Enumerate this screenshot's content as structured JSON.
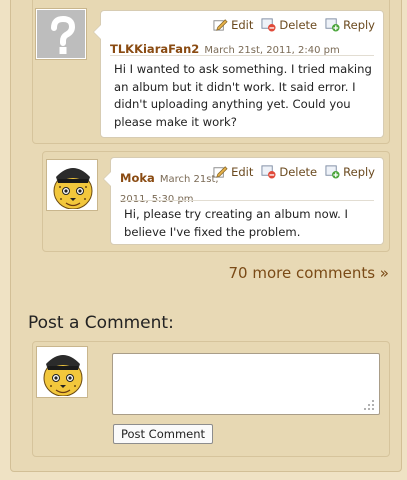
{
  "actions": {
    "edit": "Edit",
    "delete": "Delete",
    "reply": "Reply"
  },
  "comments": [
    {
      "author": "TLKKiaraFan2",
      "date": "March 21st, 2011, 2:40 pm",
      "avatar_icon": "question-mark-icon",
      "lines": [
        "Hi I wanted to ask something. I tried making",
        "an album but it didn't work. It said error. I",
        "didn't uploading anything yet. Could you",
        "please make it work?"
      ]
    },
    {
      "author": "Moka",
      "date_line1": "March 21st,",
      "date_line2": "2011, 5:30 pm",
      "avatar_icon": "cheetah-avatar-icon",
      "lines": [
        "Hi, please try creating an album now. I",
        "believe I've fixed the problem."
      ]
    }
  ],
  "more_comments": "70 more comments »",
  "post": {
    "title": "Post a Comment:",
    "textarea_value": "",
    "button": "Post Comment",
    "avatar_icon": "cheetah-avatar-icon"
  },
  "colors": {
    "page_bg": "#efe2c4",
    "panel_bg": "#e7d8b3",
    "author": "#8a4b12",
    "link": "#7a4a16"
  }
}
